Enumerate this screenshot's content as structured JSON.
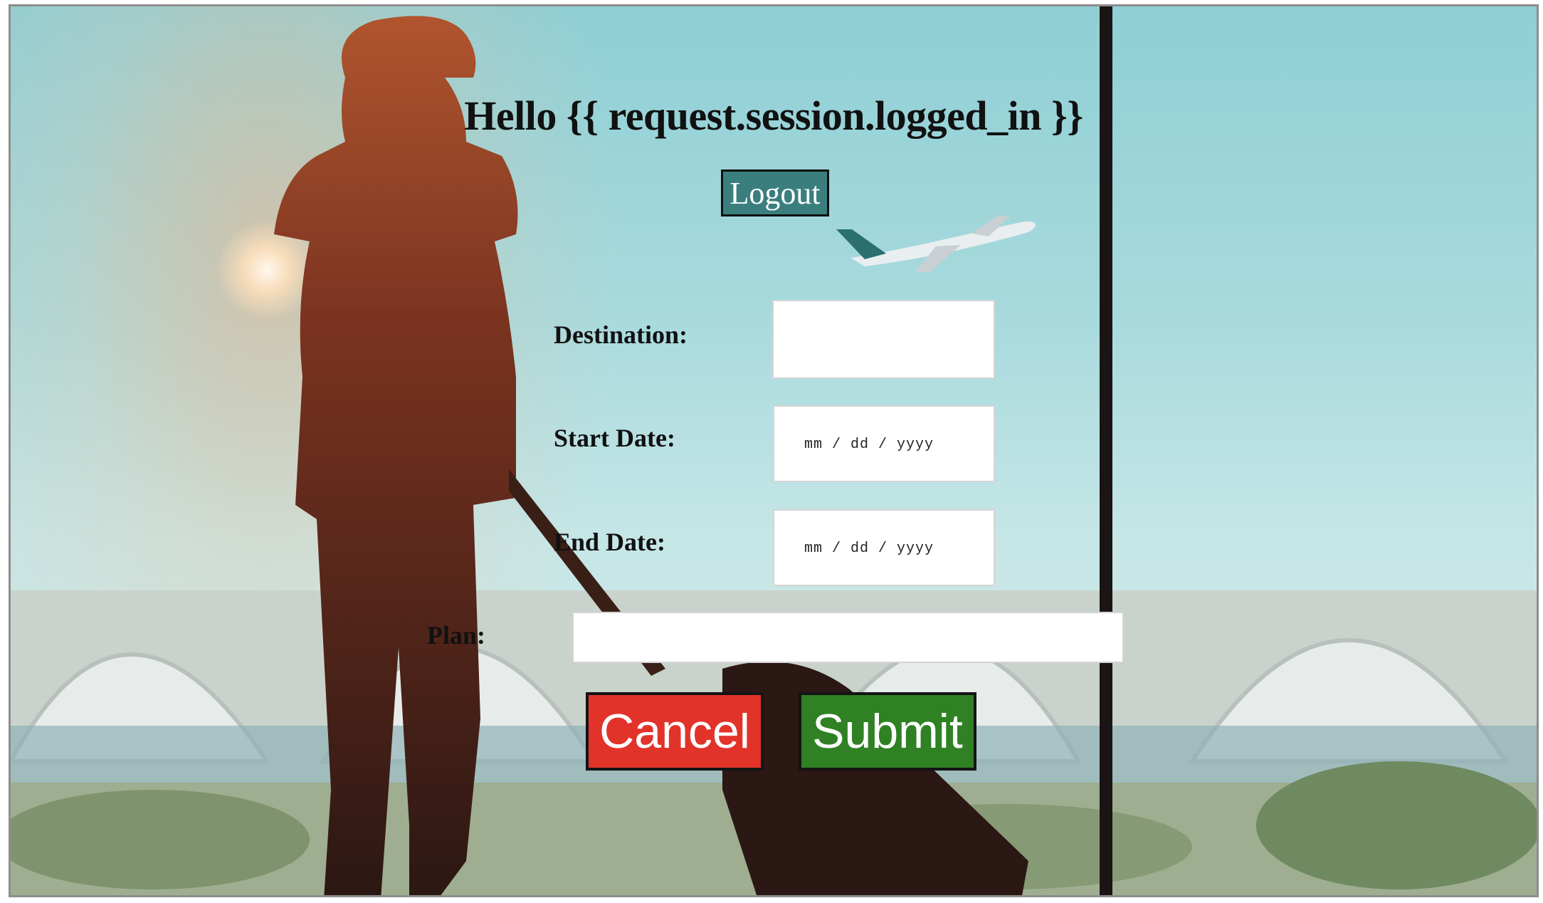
{
  "header": {
    "greeting": "Hello {{ request.session.logged_in }}"
  },
  "actions": {
    "logout_label": "Logout",
    "cancel_label": "Cancel",
    "submit_label": "Submit"
  },
  "form": {
    "destination": {
      "label": "Destination:",
      "value": ""
    },
    "start_date": {
      "label": "Start Date:",
      "placeholder": "mm / dd / yyyy"
    },
    "end_date": {
      "label": "End Date:",
      "placeholder": "mm / dd / yyyy"
    },
    "plan": {
      "label": "Plan:",
      "value": ""
    }
  },
  "colors": {
    "logout_bg": "#3a7f7d",
    "cancel_bg": "#e2332b",
    "submit_bg": "#2f8124"
  }
}
